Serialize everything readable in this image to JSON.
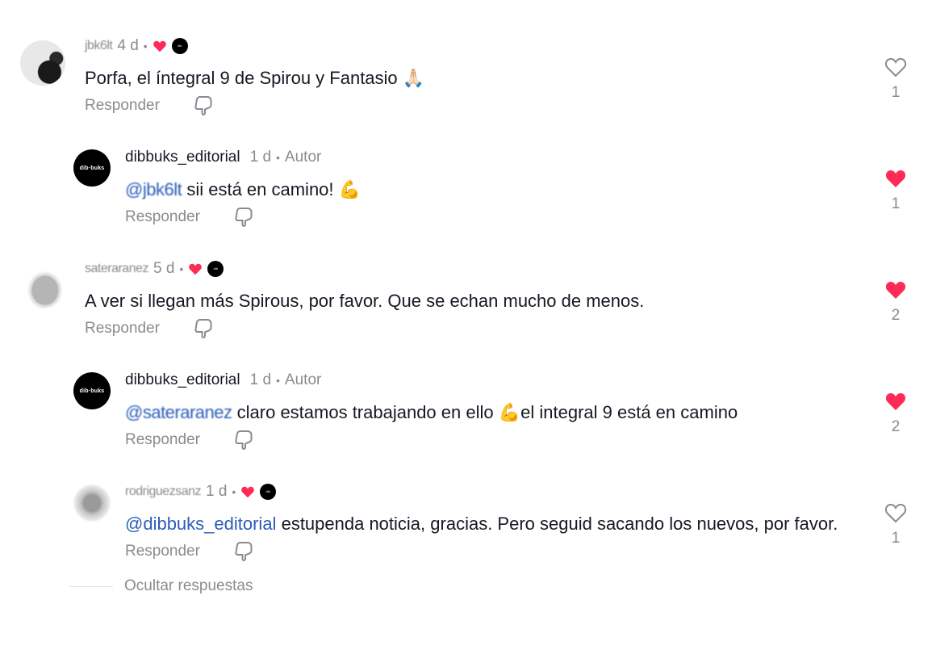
{
  "comments": [
    {
      "username": "jbk6lt",
      "time": "4 d",
      "dot": "•",
      "text": "Porfa, el íntegral 9 de Spirou y Fantasio",
      "emoji": "🙏🏻",
      "reply_label": "Responder",
      "likes": "1",
      "liked": false
    },
    {
      "username": "dibbuks_editorial",
      "avatar_text": "dib·buks",
      "time": "1 d",
      "dot": "•",
      "author_label": "Autor",
      "mention": "@jbk6lt",
      "text": "sii está en camino!",
      "emoji": "💪",
      "reply_label": "Responder",
      "likes": "1",
      "liked": true
    },
    {
      "username": "sateraranez",
      "time": "5 d",
      "dot": "•",
      "text": "A ver si llegan más Spirous, por favor. Que se echan mucho de menos.",
      "reply_label": "Responder",
      "likes": "2",
      "liked": true
    },
    {
      "username": "dibbuks_editorial",
      "avatar_text": "dib·buks",
      "time": "1 d",
      "dot": "•",
      "author_label": "Autor",
      "mention": "@sateraranez",
      "text": "claro estamos trabajando en ello",
      "emoji": "💪",
      "text_after": "el integral 9 está en camino",
      "reply_label": "Responder",
      "likes": "2",
      "liked": true
    },
    {
      "username": "rodriguezsanz",
      "time": "1 d",
      "dot": "•",
      "mention": "@dibbuks_editorial",
      "text": "estupenda noticia, gracias. Pero seguid sacando los nuevos, por favor.",
      "reply_label": "Responder",
      "likes": "1",
      "liked": false
    }
  ],
  "hide_replies_label": "Ocultar respuestas",
  "colors": {
    "heart_red": "#fe2c55",
    "muted": "#8a8b91",
    "mention": "#2b5db9",
    "text": "#161823"
  }
}
